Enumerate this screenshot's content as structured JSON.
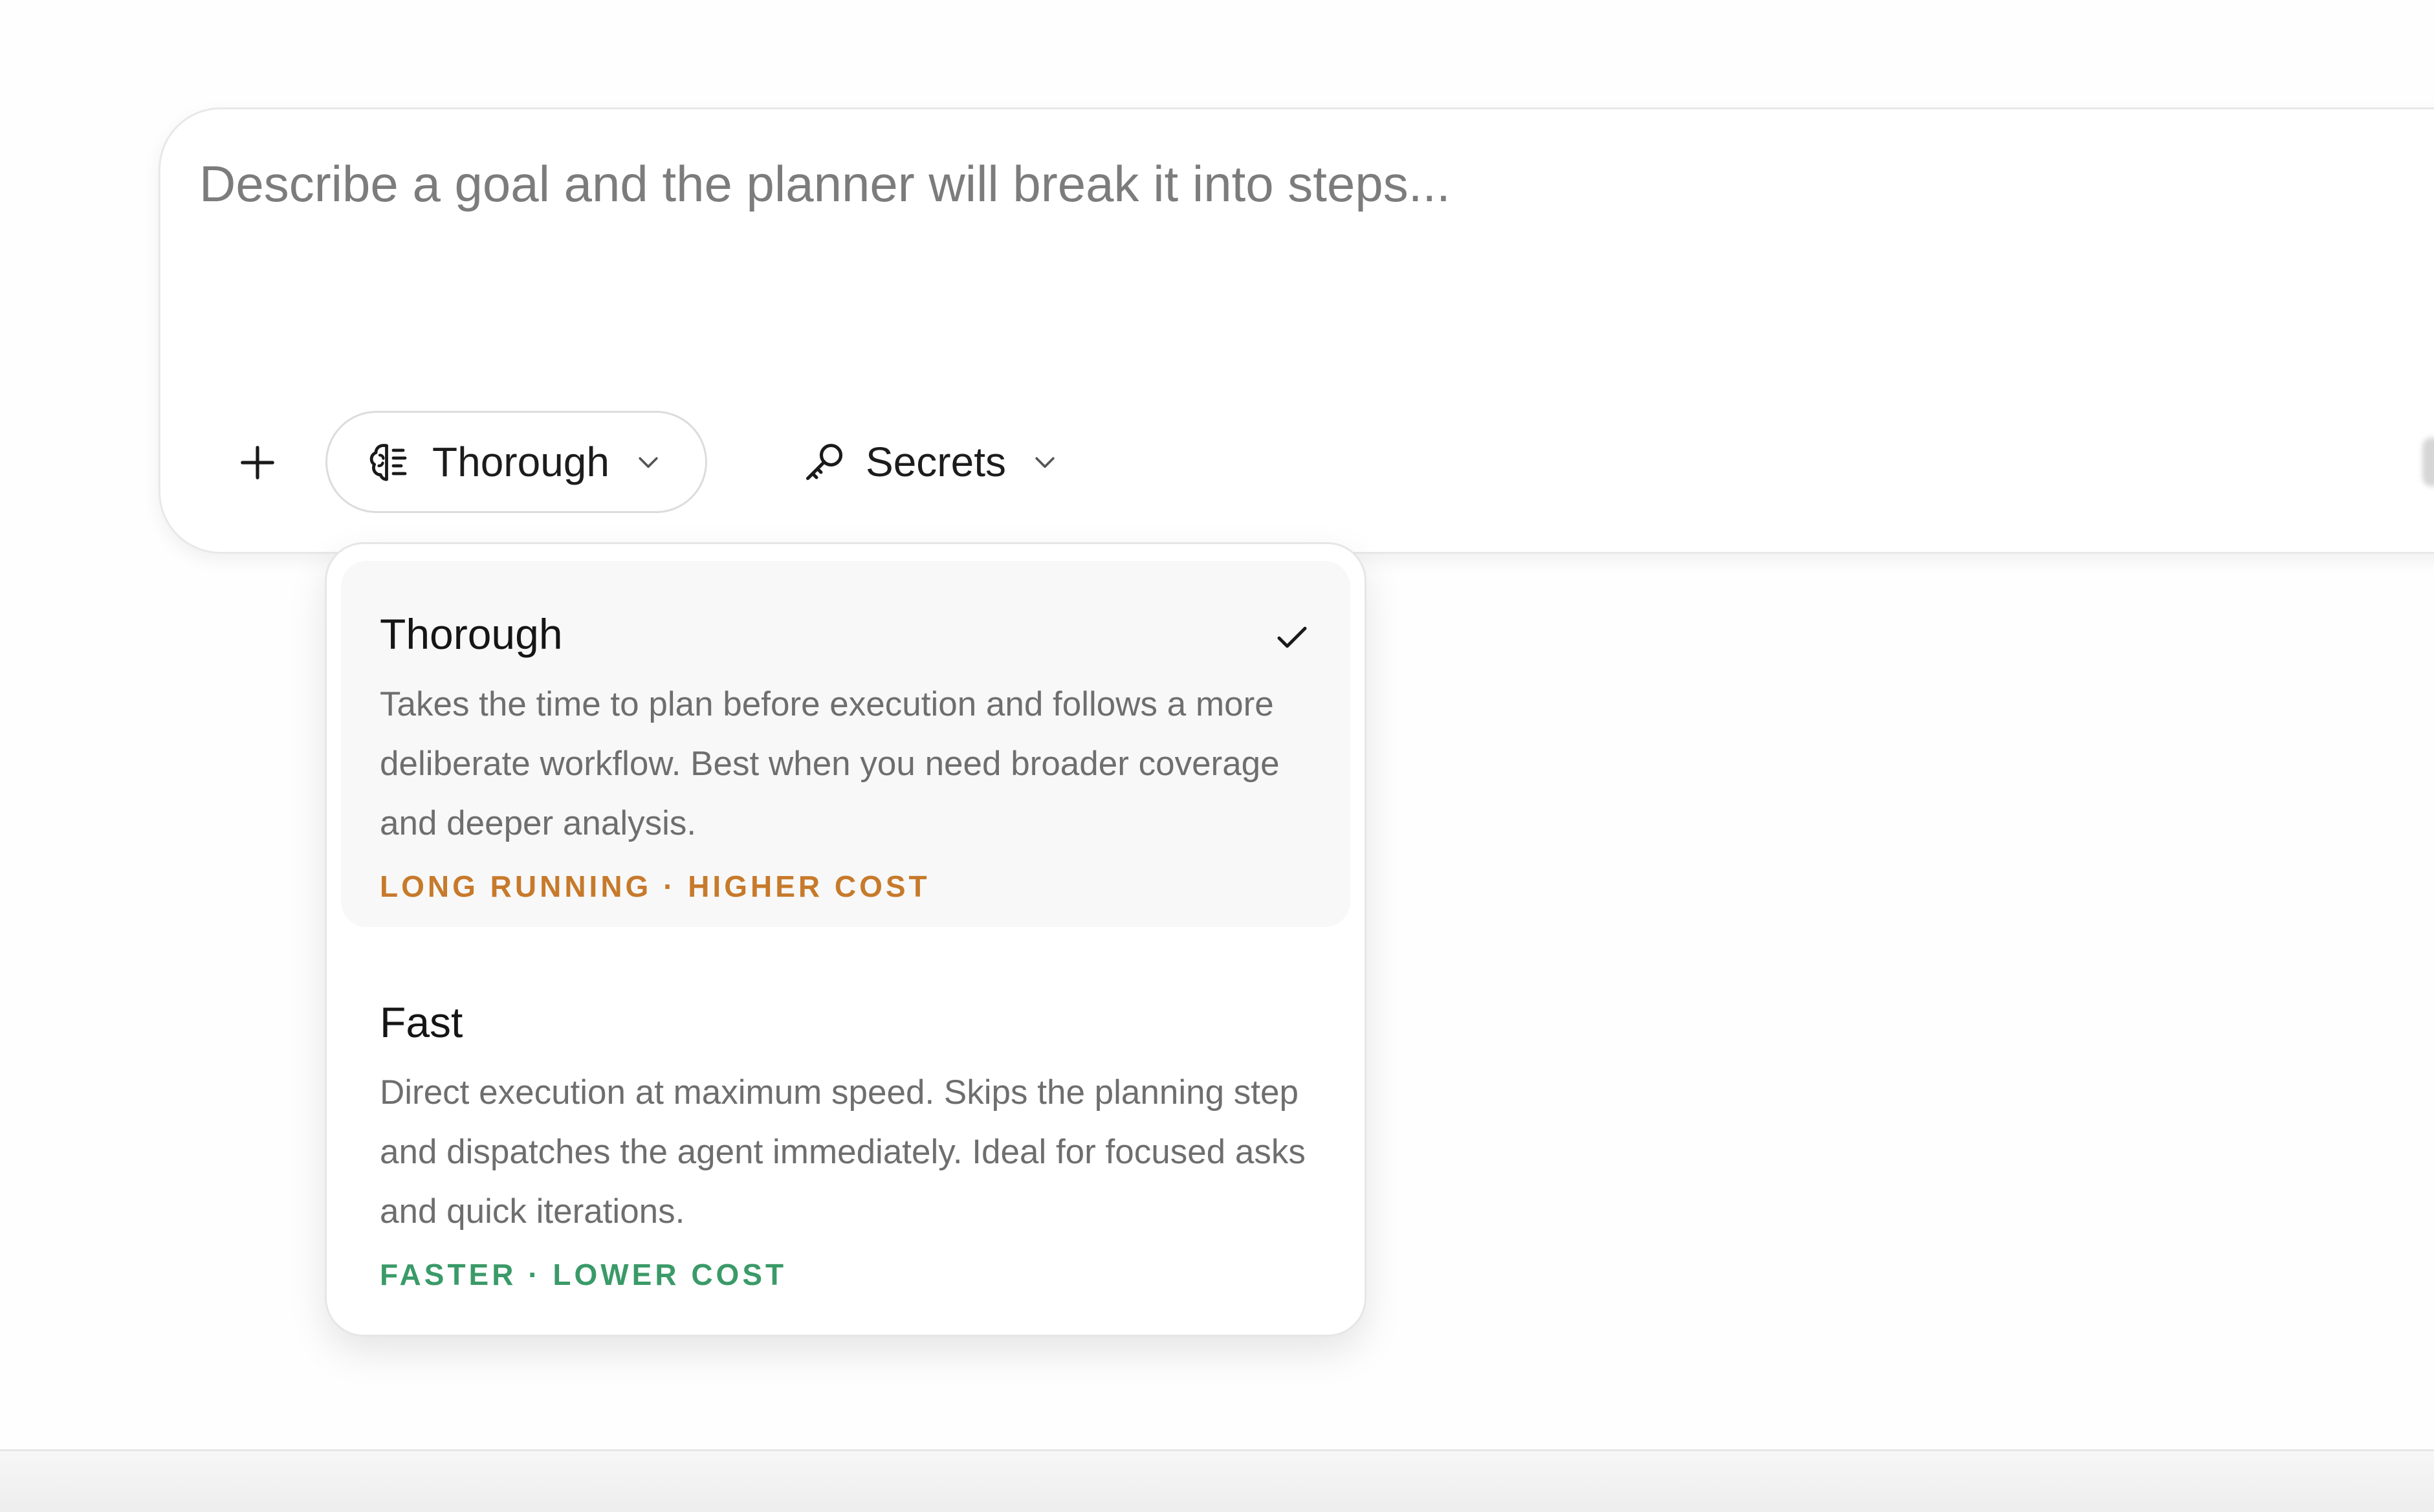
{
  "composer": {
    "placeholder": "Describe a goal and the planner will break it into steps...",
    "add_icon": "plus-icon",
    "mode": {
      "icon": "brain-icon",
      "label": "Thorough",
      "chevron_icon": "chevron-down-icon"
    },
    "secrets": {
      "icon": "key-icon",
      "label": "Secrets",
      "chevron_icon": "chevron-down-icon"
    }
  },
  "mode_menu": {
    "options": [
      {
        "title": "Thorough",
        "description": "Takes the time to plan before execution and follows a more deliberate workflow. Best when you need broader coverage and deeper analysis.",
        "tag": "LONG RUNNING · HIGHER COST",
        "tag_color": "#c77a2b",
        "selected": true,
        "check_icon": "check-icon"
      },
      {
        "title": "Fast",
        "description": "Direct execution at maximum speed. Skips the planning step and dispatches the agent immediately. Ideal for focused asks and quick iterations.",
        "tag": "FASTER · LOWER COST",
        "tag_color": "#3a9a68",
        "selected": false
      }
    ]
  }
}
